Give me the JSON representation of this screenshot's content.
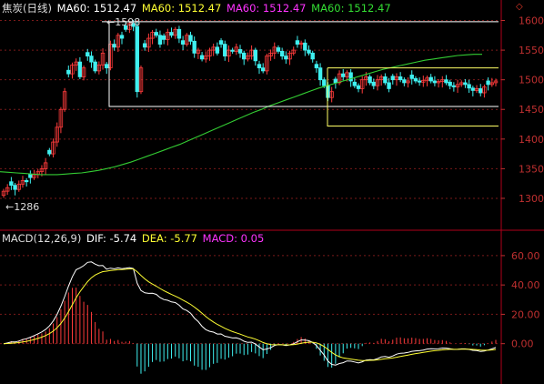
{
  "header": {
    "symbol": "焦炭(日线)",
    "ma_items": [
      {
        "label": "MA60: 1512.47",
        "color": "#ffffff"
      },
      {
        "label": "MA60: 1512.47",
        "color": "#ffff33"
      },
      {
        "label": "MA60: 1512.47",
        "color": "#ff33ff"
      },
      {
        "label": "MA60: 1512.47",
        "color": "#33dd33"
      }
    ],
    "diamond_icon": "◇"
  },
  "macd_header": {
    "name": "MACD(12,26,9)",
    "dif": "DIF: -5.74",
    "dea": "DEA: -5.77",
    "macd": "MACD: 0.05"
  },
  "annotations": {
    "high": "1598",
    "low": "1286"
  },
  "colors": {
    "up": "#ff3b3b",
    "down": "#3ff0f0",
    "ma": "#33cc33",
    "grid": "#7a1a1a",
    "axis": "#c03030",
    "frame": "#b0001a",
    "dif": "#ffffff",
    "dea": "#ffff33",
    "box": "#ffffff",
    "box2": "#ffff66"
  },
  "chart_data": [
    {
      "type": "candlestick",
      "title": "焦炭(日线)",
      "y_axis": {
        "ticks": [
          1600,
          1550,
          1500,
          1450,
          1400,
          1350,
          1300
        ],
        "range": [
          1270,
          1625
        ]
      },
      "annotations": [
        {
          "label": "1598",
          "value": 1598
        },
        {
          "label": "1286",
          "value": 1286
        }
      ],
      "close": [
        1312,
        1318,
        1322,
        1315,
        1324,
        1330,
        1328,
        1335,
        1340,
        1345,
        1350,
        1360,
        1375,
        1395,
        1420,
        1450,
        1480,
        1510,
        1525,
        1530,
        1505,
        1520,
        1540,
        1530,
        1515,
        1525,
        1545,
        1520,
        1560,
        1555,
        1575,
        1570,
        1585,
        1595,
        1590,
        1480,
        1520,
        1555,
        1570,
        1580,
        1575,
        1560,
        1568,
        1580,
        1575,
        1585,
        1570,
        1560,
        1575,
        1565,
        1545,
        1550,
        1535,
        1540,
        1550,
        1555,
        1545,
        1560,
        1540,
        1550,
        1548,
        1555,
        1545,
        1535,
        1540,
        1550,
        1532,
        1520,
        1515,
        1540,
        1545,
        1555,
        1548,
        1540,
        1535,
        1545,
        1550,
        1560,
        1562,
        1550,
        1545,
        1535,
        1520,
        1500,
        1490,
        1470,
        1480,
        1495,
        1510,
        1505,
        1512,
        1498,
        1490,
        1485,
        1500,
        1505,
        1495,
        1490,
        1500,
        1505,
        1495,
        1485,
        1500,
        1505,
        1500,
        1495,
        1498,
        1502,
        1498,
        1496,
        1499,
        1503,
        1498,
        1495,
        1497,
        1500,
        1495,
        1490,
        1488,
        1492,
        1495,
        1492,
        1486,
        1482,
        1485,
        1478,
        1488,
        1492,
        1495,
        1498
      ],
      "ma60": [
        1345,
        1344,
        1343,
        1342,
        1341,
        1340,
        1340,
        1340,
        1341,
        1342,
        1343,
        1345,
        1347,
        1350,
        1353,
        1357,
        1361,
        1366,
        1371,
        1376,
        1381,
        1386,
        1391,
        1397,
        1403,
        1409,
        1415,
        1421,
        1427,
        1433,
        1439,
        1445,
        1450,
        1456,
        1461,
        1466,
        1471,
        1476,
        1481,
        1486,
        1490,
        1494,
        1498,
        1502,
        1506,
        1510,
        1514,
        1518,
        1521,
        1524,
        1527,
        1530,
        1533,
        1535,
        1537,
        1539,
        1541,
        1542,
        1543,
        1543
      ]
    },
    {
      "type": "macd",
      "title": "MACD(12,26,9)",
      "y_axis": {
        "ticks": [
          60.0,
          40.0,
          20.0,
          0.0
        ],
        "range": [
          -25,
          68
        ]
      },
      "dif": [
        -5.74
      ],
      "dea": [
        -5.77
      ],
      "macd": [
        0.05
      ],
      "tick_labels": [
        "60.00",
        "40.00",
        "20.00",
        "0.00"
      ]
    }
  ]
}
